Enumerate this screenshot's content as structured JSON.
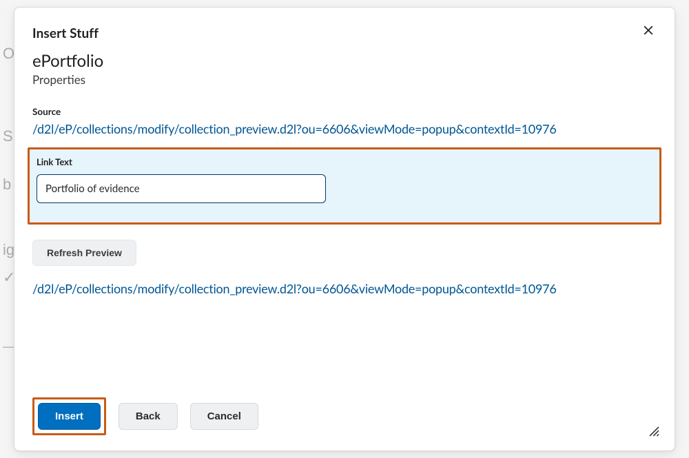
{
  "modal": {
    "title": "Insert Stuff",
    "heading": "ePortfolio",
    "subheading": "Properties",
    "source_label": "Source",
    "source_url": "/d2l/eP/collections/modify/collection_preview.d2l?ou=6606&viewMode=popup&contextId=10976",
    "linktext_label": "Link Text",
    "linktext_value": "Portfolio of evidence",
    "refresh_label": "Refresh Preview",
    "preview_url": "/d2l/eP/collections/modify/collection_preview.d2l?ou=6606&viewMode=popup&contextId=10976"
  },
  "footer": {
    "insert": "Insert",
    "back": "Back",
    "cancel": "Cancel"
  },
  "highlight_color": "#c85a17",
  "primary_color": "#006fbf"
}
